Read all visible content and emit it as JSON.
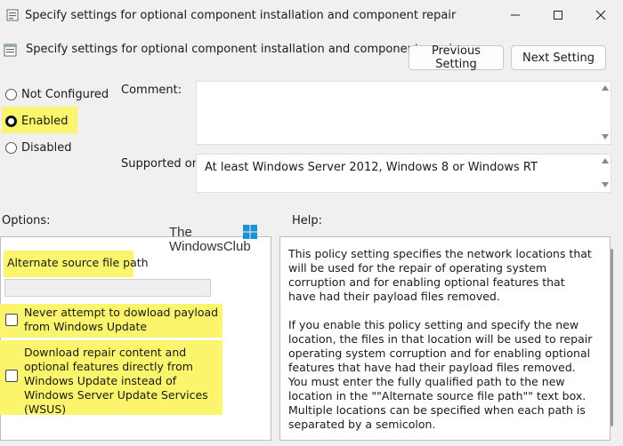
{
  "window": {
    "title": "Specify settings for optional component installation and component repair",
    "minimize": "—",
    "maximize": "☐",
    "close": "✕"
  },
  "header": {
    "title": "Specify settings for optional component installation and component repair",
    "prev_label": "Previous Setting",
    "next_label": "Next Setting"
  },
  "state": {
    "options": [
      "Not Configured",
      "Enabled",
      "Disabled"
    ],
    "selected": "Enabled"
  },
  "comment": {
    "label": "Comment:",
    "value": ""
  },
  "supported": {
    "label": "Supported on:",
    "value": "At least Windows Server 2012, Windows 8 or Windows RT"
  },
  "sections": {
    "options_label": "Options:",
    "help_label": "Help:"
  },
  "watermark": {
    "line1": "The",
    "line2": "WindowsClub"
  },
  "options": {
    "alt_source_label": "Alternate source file path",
    "alt_source_value": "",
    "check1_label": "Never attempt to dowload payload from Windows Update",
    "check1_checked": false,
    "check2_label": "Download repair content and optional features directly from Windows Update instead of Windows Server Update Services (WSUS)",
    "check2_checked": false
  },
  "help": {
    "paragraphs": [
      "This policy setting specifies the network locations that will be used for the repair of operating system corruption and for enabling optional features that have had their payload files removed.",
      "If you enable this policy setting and specify the new location, the files in that location will be used to repair operating system corruption and for enabling optional features that have had their payload files removed. You must enter the fully qualified path to the new location in the \"\"Alternate source file path\"\" text box. Multiple locations can be specified when each path is separated by a semicolon."
    ]
  },
  "colors": {
    "highlight": "#fbf46d",
    "window_bg": "#f0f0f0"
  }
}
